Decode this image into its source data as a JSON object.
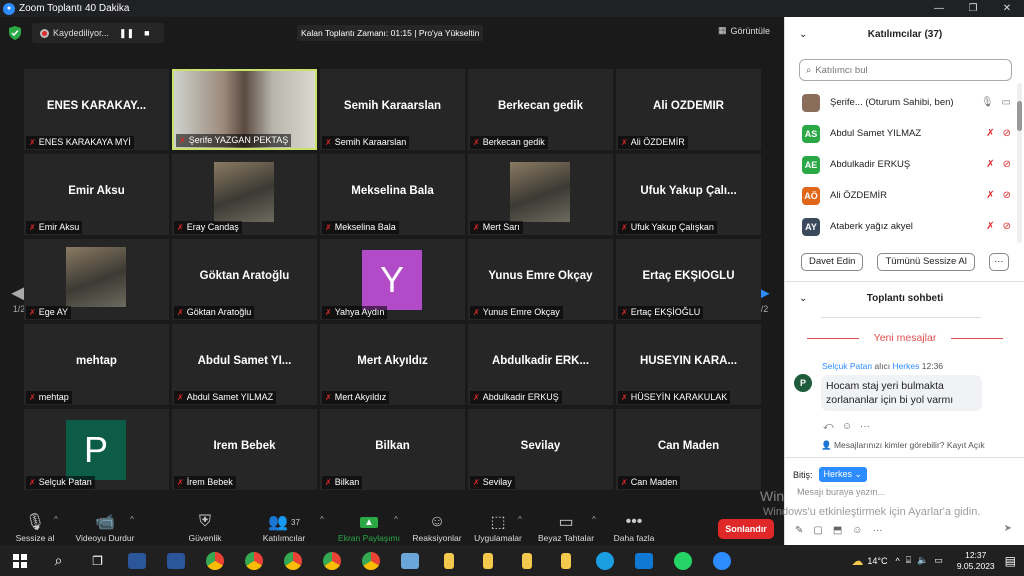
{
  "window": {
    "title": "Zoom Toplantı 40 Dakika"
  },
  "topbar": {
    "recording_label": "Kaydediliyor...",
    "timer_text": "Kalan Toplantı Zamanı: 01:15 | Pro'ya Yükseltin",
    "view_label": "Görüntüle"
  },
  "grid": {
    "page_left": "1/2",
    "page_right": "1/2",
    "tiles": [
      {
        "display": "ENES KARAKAY...",
        "label": "ENES KARAKAYA MYİ",
        "type": "name"
      },
      {
        "display": "",
        "label": "Şerife YAZGAN PEKTAŞ",
        "type": "video-active"
      },
      {
        "display": "Semih Karaarslan",
        "label": "Semih Karaarslan",
        "type": "name"
      },
      {
        "display": "Berkecan gedik",
        "label": "Berkecan gedik",
        "type": "name"
      },
      {
        "display": "Ali ÖZDEMİR",
        "label": "Ali ÖZDEMİR",
        "type": "name"
      },
      {
        "display": "Emir Aksu",
        "label": "Emir Aksu",
        "type": "name"
      },
      {
        "display": "",
        "label": "Eray Candaş",
        "type": "photo"
      },
      {
        "display": "Mekselina Bala",
        "label": "Mekselina Bala",
        "type": "name"
      },
      {
        "display": "",
        "label": "Mert Sarı",
        "type": "photo"
      },
      {
        "display": "Ufuk Yakup Çalı...",
        "label": "Ufuk Yakup Çalışkan",
        "type": "name"
      },
      {
        "display": "",
        "label": "Ege AY",
        "type": "photo"
      },
      {
        "display": "Göktan Aratoğlu",
        "label": "Göktan Aratoğlu",
        "type": "name"
      },
      {
        "display": "Y",
        "label": "Yahya Aydın",
        "type": "avatar",
        "color": "#b24bc7"
      },
      {
        "display": "Yunus Emre Okçay",
        "label": "Yunus Emre Okçay",
        "type": "name"
      },
      {
        "display": "Ertaç EKŞİOĞLU",
        "label": "Ertaç EKŞİOĞLU",
        "type": "name"
      },
      {
        "display": "mehtap",
        "label": "mehtap",
        "type": "name"
      },
      {
        "display": "Abdul Samet YI...",
        "label": "Abdul Samet YILMAZ",
        "type": "name"
      },
      {
        "display": "Mert Akyıldız",
        "label": "Mert Akyıldız",
        "type": "name"
      },
      {
        "display": "Abdulkadir ERK...",
        "label": "Abdulkadir ERKUŞ",
        "type": "name"
      },
      {
        "display": "HÜSEYİN KARA...",
        "label": "HÜSEYİN KARAKULAK",
        "type": "name"
      },
      {
        "display": "P",
        "label": "Selçuk Patan",
        "type": "avatar",
        "color": "#0d5c48"
      },
      {
        "display": "İrem Bebek",
        "label": "İrem Bebek",
        "type": "name"
      },
      {
        "display": "Bilkan",
        "label": "Bilkan",
        "type": "name"
      },
      {
        "display": "Sevilay",
        "label": "Sevilay",
        "type": "name"
      },
      {
        "display": "Can Maden",
        "label": "Can Maden",
        "type": "name"
      }
    ]
  },
  "controls": {
    "mute": "Sessize al",
    "video": "Videoyu Durdur",
    "security": "Güvenlik",
    "participants": "Katılımcılar",
    "participants_count": "37",
    "share": "Ekran Paylaşımı",
    "reactions": "Reaksiyonlar",
    "apps": "Uygulamalar",
    "whiteboard": "Beyaz Tahtalar",
    "more": "Daha fazla",
    "end": "Sonlandır"
  },
  "participants_panel": {
    "title": "Katılımcılar (37)",
    "search_placeholder": "Katılımcı bul",
    "list": [
      {
        "initials": "",
        "name": "Şerife... (Oturum Sahibi, ben)",
        "color": "#8a6d5a",
        "host": true
      },
      {
        "initials": "AS",
        "name": "Abdul Samet YILMAZ",
        "color": "#2aa845"
      },
      {
        "initials": "AE",
        "name": "Abdulkadir ERKUŞ",
        "color": "#2aa845"
      },
      {
        "initials": "AÖ",
        "name": "Ali ÖZDEMİR",
        "color": "#e0661a"
      },
      {
        "initials": "AY",
        "name": "Ataberk yağız akyel",
        "color": "#3a4a5c"
      }
    ],
    "invite": "Davet Edin",
    "mute_all": "Tümünü Sessize Al",
    "more": "···"
  },
  "chat_panel": {
    "title": "Toplantı sohbeti",
    "new_messages": "Yeni mesajlar",
    "sender": "Selçuk Patan",
    "to_word": "alıcı",
    "recipient": "Herkes",
    "time": "12:36",
    "avatar": "P",
    "message": "Hocam staj yeri bulmakta zorlananlar için bi yol varmı",
    "privacy": "Mesajlarınızı kimler görebilir? Kayıt Açık",
    "send_to_label": "Bitiş:",
    "send_to_value": "Herkes ⌄",
    "input_placeholder": "Mesajı buraya yazın..."
  },
  "watermark": {
    "line1": "Windows'u Etkinleştir",
    "line2": "Windows'u etkinleştirmek için Ayarlar'a gidin."
  },
  "taskbar": {
    "temperature": "14°C",
    "time": "12:37",
    "date": "9.05.2023"
  }
}
